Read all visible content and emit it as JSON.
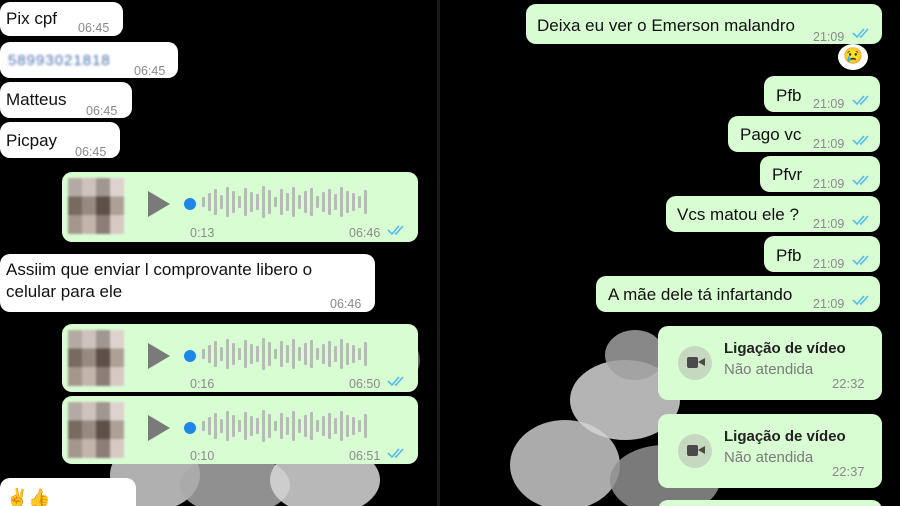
{
  "left_chat": {
    "msg_pixcpf": {
      "text": "Pix cpf",
      "time": "06:45"
    },
    "msg_cpf": {
      "text": "58993021818",
      "time": "06:45"
    },
    "msg_matteus": {
      "text": "Matteus",
      "time": "06:45"
    },
    "msg_picpay": {
      "text": "Picpay",
      "time": "06:45"
    },
    "voice1": {
      "duration": "0:13",
      "time": "06:46"
    },
    "msg_assiim": {
      "text": "Assiim que enviar l comprovante libero o celular para ele",
      "time": "06:46"
    },
    "voice2": {
      "duration": "0:16",
      "time": "06:50"
    },
    "voice3": {
      "duration": "0:10",
      "time": "06:51"
    },
    "msg_emoji": {
      "text": "✌️👍"
    }
  },
  "right_chat": {
    "msg1": {
      "text": "Deixa eu ver o Emerson malandro",
      "time": "21:09"
    },
    "reaction": {
      "text": "😢"
    },
    "msg2": {
      "text": "Pfb",
      "time": "21:09"
    },
    "msg3": {
      "text": "Pago vc",
      "time": "21:09"
    },
    "msg4": {
      "text": "Pfvr",
      "time": "21:09"
    },
    "msg5": {
      "text": "Vcs matou ele ?",
      "time": "21:09"
    },
    "msg6": {
      "text": "Pfb",
      "time": "21:09"
    },
    "msg7": {
      "text": "A mãe dele tá infartando",
      "time": "21:09"
    },
    "call1": {
      "title": "Ligação de vídeo",
      "status": "Não atendida",
      "time": "22:32"
    },
    "call2": {
      "title": "Ligação de vídeo",
      "status": "Não atendida",
      "time": "22:37"
    }
  },
  "colors": {
    "incoming_bubble": "#ffffff",
    "outgoing_bubble": "#d9fdd3",
    "read_ticks": "#53bdeb",
    "background": "#000000"
  },
  "icons": [
    "play-icon",
    "read-ticks-icon",
    "video-call-icon"
  ]
}
